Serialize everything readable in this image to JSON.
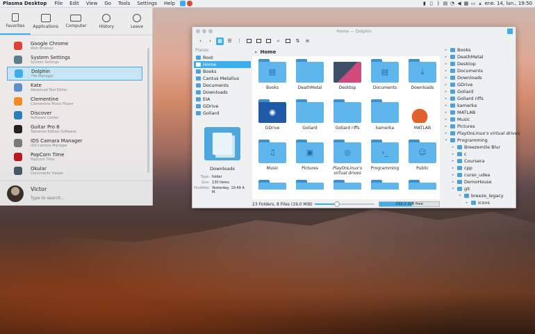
{
  "topbar": {
    "app_title": "Plasma Desktop",
    "menu": [
      "File",
      "Edit",
      "View",
      "Go",
      "Tools",
      "Settings",
      "Help"
    ],
    "clock": "ene. 14, lun., 19:50"
  },
  "launcher": {
    "tabs": [
      {
        "label": "Favorites",
        "icon": "bookmark-icon"
      },
      {
        "label": "Applications",
        "icon": "grid-icon"
      },
      {
        "label": "Computer",
        "icon": "monitor-icon"
      },
      {
        "label": "History",
        "icon": "clock-icon"
      },
      {
        "label": "Leave",
        "icon": "arrow-left-icon"
      }
    ],
    "apps": [
      {
        "name": "Google Chrome",
        "desc": "Web Browser",
        "color": "#db4437"
      },
      {
        "name": "System Settings",
        "desc": "System Settings",
        "color": "#607d8b"
      },
      {
        "name": "Dolphin",
        "desc": "File Manager",
        "color": "#3daee9"
      },
      {
        "name": "Kate",
        "desc": "Advanced Text Editor",
        "color": "#5d8fc8"
      },
      {
        "name": "Clementine",
        "desc": "Clementine Music Player",
        "color": "#f08a24"
      },
      {
        "name": "Discover",
        "desc": "Software Center",
        "color": "#2980b9"
      },
      {
        "name": "Guitar Pro 6",
        "desc": "Tablature Edition Software",
        "color": "#222222"
      },
      {
        "name": "IDS Camara Manager",
        "desc": "IDS Camera Manager",
        "color": "#7a7a7a"
      },
      {
        "name": "PopCorn Time",
        "desc": "PopCorn Time",
        "color": "#b71c1c"
      },
      {
        "name": "Okular",
        "desc": "Documents Viewer",
        "color": "#455a64"
      }
    ],
    "user_name": "Victor",
    "search_placeholder": "Type to search..."
  },
  "dolphin": {
    "title": "Home — Dolphin",
    "places_title": "Places",
    "places": [
      "Root",
      "Home",
      "Books",
      "Cantus Metallus",
      "Documents",
      "Downloads",
      "EIA",
      "GDrive",
      "Goliard"
    ],
    "breadcrumb": "Home",
    "info": {
      "name": "Downloads",
      "type_label": "Type:",
      "type_value": "folder",
      "size_label": "Size:",
      "size_value": "130 items",
      "modified_label": "Modified:",
      "modified_value": "Yesterday, 10:49 A M."
    },
    "files": [
      {
        "label": "Books",
        "glyph": "▤",
        "kind": "folder"
      },
      {
        "label": "DeathMetal",
        "glyph": "",
        "kind": "folder"
      },
      {
        "label": "Desktop",
        "glyph": "",
        "kind": "special"
      },
      {
        "label": "Documents",
        "glyph": "▤",
        "kind": "folder"
      },
      {
        "label": "Downloads",
        "glyph": "⤓",
        "kind": "folder"
      },
      {
        "label": "GDrive",
        "glyph": "◉",
        "kind": "gdrive"
      },
      {
        "label": "Goliard",
        "glyph": "",
        "kind": "folder"
      },
      {
        "label": "Goliard riffs",
        "glyph": "",
        "kind": "folder"
      },
      {
        "label": "kamerka",
        "glyph": "",
        "kind": "folder"
      },
      {
        "label": "MATLAB",
        "glyph": "",
        "kind": "matlab"
      },
      {
        "label": "Music",
        "glyph": "♫",
        "kind": "folder"
      },
      {
        "label": "Pictures",
        "glyph": "▣",
        "kind": "folder"
      },
      {
        "label": "PlayOnLinux's virtual drives",
        "glyph": "◎",
        "kind": "folder",
        "italic": true
      },
      {
        "label": "Programming",
        "glyph": "›_",
        "kind": "folder"
      },
      {
        "label": "Public",
        "glyph": "☺",
        "kind": "folder"
      }
    ],
    "status": "23 Folders, 8 Files (19,0 MiB)",
    "free_space": "292,1 GiB free",
    "free_space_fill": 0.55,
    "zoom_fill": 0.4,
    "tree": [
      {
        "label": "Books",
        "level": 0
      },
      {
        "label": "DeathMetal",
        "level": 0
      },
      {
        "label": "Desktop",
        "level": 0
      },
      {
        "label": "Documents",
        "level": 0
      },
      {
        "label": "Downloads",
        "level": 0
      },
      {
        "label": "GDrive",
        "level": 0
      },
      {
        "label": "Goliard",
        "level": 0
      },
      {
        "label": "Goliard riffs",
        "level": 0
      },
      {
        "label": "kamerka",
        "level": 0
      },
      {
        "label": "MATLAB",
        "level": 0
      },
      {
        "label": "Music",
        "level": 0
      },
      {
        "label": "Pictures",
        "level": 0
      },
      {
        "label": "PlayOnLinux's virtual drives",
        "level": 0,
        "italic": true
      },
      {
        "label": "Programming",
        "level": 0,
        "open": true
      },
      {
        "label": "Breezemite Blur",
        "level": 1
      },
      {
        "label": "c",
        "level": 1
      },
      {
        "label": "Coursera",
        "level": 1
      },
      {
        "label": "cpp",
        "level": 1
      },
      {
        "label": "curso_udea",
        "level": 1
      },
      {
        "label": "DemoHouse",
        "level": 1
      },
      {
        "label": "git",
        "level": 1,
        "open": true
      },
      {
        "label": "breeze_legacy",
        "level": 2,
        "open": true
      },
      {
        "label": "icons",
        "level": 3
      }
    ]
  }
}
